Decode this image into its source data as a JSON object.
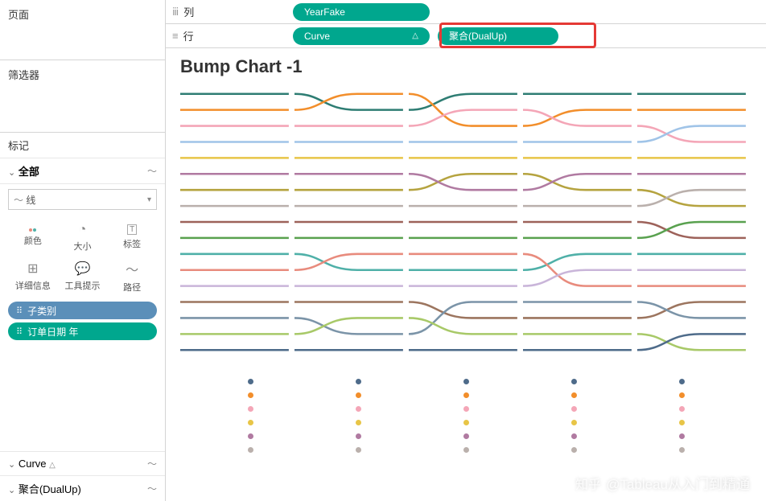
{
  "left": {
    "pages_label": "页面",
    "filters_label": "筛选器",
    "marks_label": "标记",
    "all_label": "全部",
    "mark_type": "线",
    "buttons": {
      "color": "颜色",
      "size": "大小",
      "label": "标签",
      "detail": "详细信息",
      "tooltip": "工具提示",
      "path": "路径"
    },
    "pill1": "子类别",
    "pill2": "订单日期 年",
    "section_curve": "Curve",
    "section_dualup": "聚合(DualUp)"
  },
  "shelves": {
    "columns_label": "列",
    "rows_label": "行",
    "columns_pill": "YearFake",
    "rows_pill1": "Curve",
    "rows_pill2": "聚合(DualUp)"
  },
  "chart": {
    "title": "Bump Chart -1"
  },
  "watermark": "@Tableau从入门到精通",
  "chart_data": {
    "type": "line",
    "title": "Bump Chart -1",
    "xlabel": "",
    "ylabel": "",
    "x_segments": [
      0,
      1,
      2,
      3,
      4
    ],
    "ylim": [
      1,
      17
    ],
    "colors": {
      "teal_dark": "#2e7d73",
      "orange": "#f28e2b",
      "pink": "#f4a6b7",
      "blue_light": "#a0c4e8",
      "olive": "#b5a33f",
      "yellow": "#e8c547",
      "gray": "#bab0ac",
      "purple": "#b07aa1",
      "red_brown": "#9d625a",
      "green": "#59a14f",
      "teal": "#4fb0a8",
      "salmon": "#e88b7d",
      "lavender": "#c9b5d9",
      "brown": "#9c755f",
      "blue_gray": "#7b94a8",
      "navy": "#4e6b8a",
      "lime": "#a8c968"
    },
    "series": [
      {
        "name": "teal_dark",
        "ranks": [
          1,
          2,
          1,
          1,
          1
        ]
      },
      {
        "name": "orange",
        "ranks": [
          2,
          1,
          3,
          2,
          2
        ]
      },
      {
        "name": "pink",
        "ranks": [
          3,
          3,
          2,
          3,
          4
        ]
      },
      {
        "name": "blue_light",
        "ranks": [
          4,
          4,
          4,
          4,
          3
        ]
      },
      {
        "name": "yellow",
        "ranks": [
          5,
          5,
          5,
          5,
          5
        ]
      },
      {
        "name": "olive",
        "ranks": [
          7,
          7,
          6,
          7,
          8
        ]
      },
      {
        "name": "purple",
        "ranks": [
          6,
          6,
          7,
          6,
          6
        ]
      },
      {
        "name": "gray",
        "ranks": [
          8,
          8,
          8,
          8,
          7
        ]
      },
      {
        "name": "red_brown",
        "ranks": [
          9,
          9,
          9,
          9,
          10
        ]
      },
      {
        "name": "green",
        "ranks": [
          10,
          10,
          10,
          10,
          9
        ]
      },
      {
        "name": "teal",
        "ranks": [
          11,
          12,
          12,
          11,
          11
        ]
      },
      {
        "name": "salmon",
        "ranks": [
          12,
          11,
          11,
          13,
          13
        ]
      },
      {
        "name": "lavender",
        "ranks": [
          13,
          13,
          13,
          12,
          12
        ]
      },
      {
        "name": "brown",
        "ranks": [
          14,
          14,
          15,
          15,
          14
        ]
      },
      {
        "name": "blue_gray",
        "ranks": [
          15,
          16,
          14,
          14,
          15
        ]
      },
      {
        "name": "lime",
        "ranks": [
          16,
          15,
          16,
          16,
          17
        ]
      },
      {
        "name": "navy",
        "ranks": [
          17,
          17,
          17,
          17,
          16
        ]
      }
    ],
    "dots_below": {
      "columns": 5,
      "per_column_colors": [
        "#4e6b8a",
        "#f28e2b",
        "#f4a6b7",
        "#e8c547",
        "#b07aa1",
        "#bab0ac"
      ]
    }
  }
}
